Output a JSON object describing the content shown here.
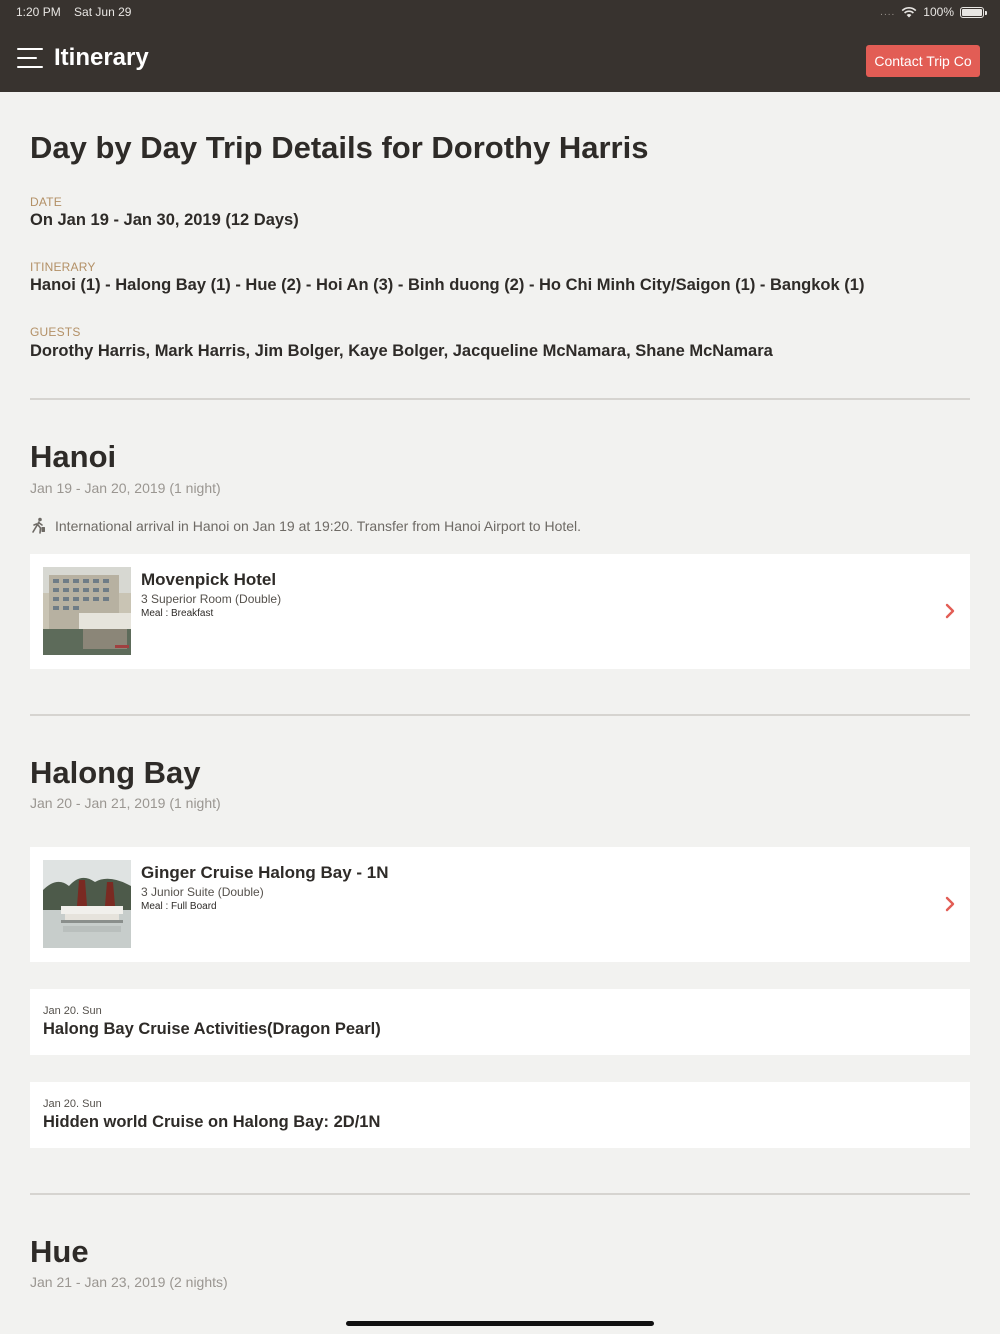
{
  "status_bar": {
    "time": "1:20 PM",
    "date": "Sat Jun 29",
    "signal": "....",
    "battery": "100%",
    "battery_level": 1.0
  },
  "header": {
    "title": "Itinerary",
    "contact_label": "Contact Trip Co"
  },
  "trip": {
    "title": "Day by Day Trip Details for Dorothy Harris",
    "date_label": "DATE",
    "date_value": "On Jan 19 - Jan 30, 2019 (12 Days)",
    "itinerary_label": "ITINERARY",
    "itinerary_value": "Hanoi (1) - Halong Bay (1) - Hue (2) - Hoi An (3) - Binh duong (2) - Ho Chi Minh City/Saigon (1) - Bangkok (1)",
    "guests_label": "GUESTS",
    "guests_value": "Dorothy Harris, Mark Harris, Jim Bolger, Kaye Bolger, Jacqueline McNamara, Shane McNamara"
  },
  "sections": [
    {
      "city": "Hanoi",
      "dates": "Jan 19 - Jan 20, 2019 (1 night)",
      "arrival": "International arrival in Hanoi on Jan 19 at 19:20. Transfer from Hanoi Airport to Hotel.",
      "hotel": {
        "name": "Movenpick Hotel",
        "room": "3 Superior Room (Double)",
        "meal": "Meal : Breakfast"
      }
    },
    {
      "city": "Halong Bay",
      "dates": "Jan 20 - Jan 21, 2019 (1 night)",
      "hotel": {
        "name": "Ginger Cruise Halong Bay - 1N",
        "room": "3 Junior Suite (Double)",
        "meal": "Meal : Full Board"
      },
      "activities": [
        {
          "date": "Jan 20. Sun",
          "title": "Halong Bay Cruise Activities(Dragon Pearl)"
        },
        {
          "date": "Jan 20. Sun",
          "title": "Hidden world Cruise on Halong Bay: 2D/1N"
        }
      ]
    },
    {
      "city": "Hue",
      "dates": "Jan 21 - Jan 23, 2019 (2 nights)"
    }
  ],
  "icons": {
    "menu": "menu-icon",
    "arrival": "walking-traveler-icon",
    "chevron": "chevron-right-icon",
    "wifi": "wifi-icon",
    "battery": "battery-icon"
  },
  "colors": {
    "header_bg": "#38332f",
    "accent": "#e25d55",
    "label": "#b39066",
    "background": "#f2f2f0"
  }
}
